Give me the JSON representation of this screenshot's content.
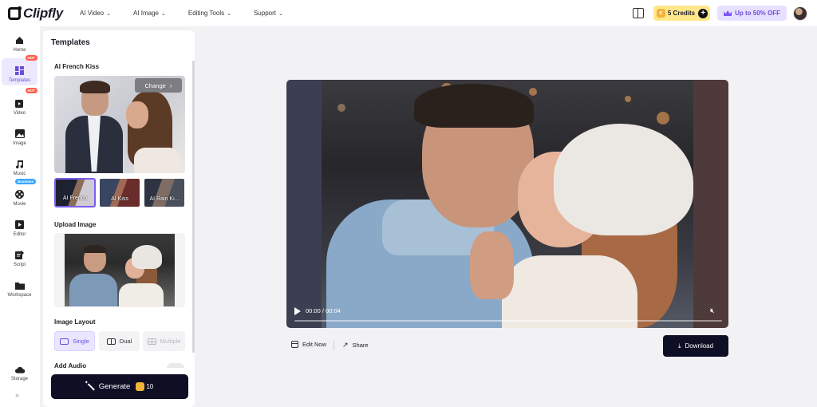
{
  "header": {
    "logo_text": "Clipfly",
    "nav": [
      {
        "label": "AI Video"
      },
      {
        "label": "AI Image"
      },
      {
        "label": "Editing Tools"
      },
      {
        "label": "Support"
      }
    ],
    "credits_label": "5 Credits",
    "promo_label": "Up to 50% OFF",
    "accent_color": "#6a4ddb"
  },
  "rail": {
    "items": [
      {
        "label": "Home",
        "icon": "home-icon"
      },
      {
        "label": "Templates",
        "icon": "templates-icon",
        "badge": "HOT"
      },
      {
        "label": "Video",
        "icon": "video-icon",
        "badge": "HOT"
      },
      {
        "label": "Image",
        "icon": "image-icon"
      },
      {
        "label": "Music",
        "icon": "music-icon"
      },
      {
        "label": "Movie",
        "icon": "movie-icon",
        "badge": "Business"
      },
      {
        "label": "Editor",
        "icon": "editor-icon"
      },
      {
        "label": "Script",
        "icon": "script-icon"
      },
      {
        "label": "Workspace",
        "icon": "folder-icon"
      },
      {
        "label": "Storage",
        "icon": "cloud-icon"
      }
    ]
  },
  "panel": {
    "title": "Templates",
    "template_name": "AI French Kiss",
    "change_label": "Change",
    "thumbs": [
      {
        "label": "AI French"
      },
      {
        "label": "AI Kiss"
      },
      {
        "label": "AI Rain Ki..."
      }
    ],
    "upload_label": "Upload Image",
    "layout_label": "Image Layout",
    "layout_options": [
      {
        "label": "Single"
      },
      {
        "label": "Dual"
      },
      {
        "label": "Multiple"
      }
    ],
    "add_audio_label": "Add Audio",
    "generate_label": "Generate",
    "generate_cost": "10"
  },
  "player": {
    "time": "00:00 / 00:04",
    "progress": 0
  },
  "actions": {
    "edit_label": "Edit Now",
    "share_label": "Share",
    "download_label": "Download"
  }
}
